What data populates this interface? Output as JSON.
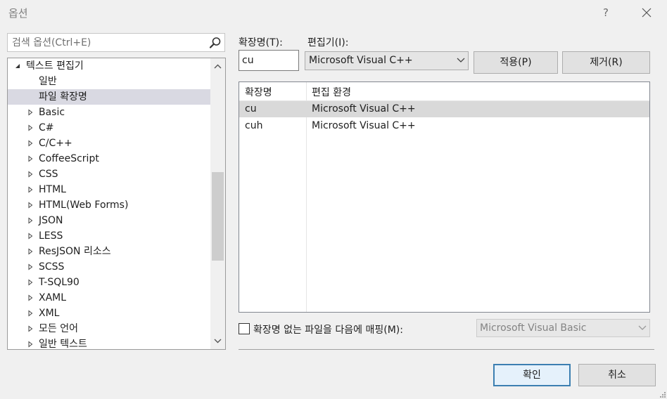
{
  "window": {
    "title": "옵션",
    "help": "?"
  },
  "search": {
    "placeholder": "검색 옵션(Ctrl+E)"
  },
  "tree": {
    "items": [
      {
        "label": "텍스트 편집기",
        "arrow": "expanded",
        "level": 0
      },
      {
        "label": "일반",
        "arrow": "none",
        "level": 1
      },
      {
        "label": "파일 확장명",
        "arrow": "none",
        "level": 1,
        "selected": true
      },
      {
        "label": "Basic",
        "arrow": "collapsed",
        "level": 1
      },
      {
        "label": "C#",
        "arrow": "collapsed",
        "level": 1
      },
      {
        "label": "C/C++",
        "arrow": "collapsed",
        "level": 1
      },
      {
        "label": "CoffeeScript",
        "arrow": "collapsed",
        "level": 1
      },
      {
        "label": "CSS",
        "arrow": "collapsed",
        "level": 1
      },
      {
        "label": "HTML",
        "arrow": "collapsed",
        "level": 1
      },
      {
        "label": "HTML(Web Forms)",
        "arrow": "collapsed",
        "level": 1
      },
      {
        "label": "JSON",
        "arrow": "collapsed",
        "level": 1
      },
      {
        "label": "LESS",
        "arrow": "collapsed",
        "level": 1
      },
      {
        "label": "ResJSON 리소스",
        "arrow": "collapsed",
        "level": 1
      },
      {
        "label": "SCSS",
        "arrow": "collapsed",
        "level": 1
      },
      {
        "label": "T-SQL90",
        "arrow": "collapsed",
        "level": 1
      },
      {
        "label": "XAML",
        "arrow": "collapsed",
        "level": 1
      },
      {
        "label": "XML",
        "arrow": "collapsed",
        "level": 1
      },
      {
        "label": "모든 언어",
        "arrow": "collapsed",
        "level": 1
      },
      {
        "label": "일반 텍스트",
        "arrow": "collapsed",
        "level": 1
      }
    ]
  },
  "extension": {
    "label": "확장명(T):",
    "value": "cu"
  },
  "editor": {
    "label": "편집기(I):",
    "selected": "Microsoft Visual C++"
  },
  "buttons": {
    "apply": "적용(P)",
    "remove": "제거(R)",
    "ok": "확인",
    "cancel": "취소"
  },
  "list": {
    "headers": [
      "확장명",
      "편집 환경"
    ],
    "rows": [
      {
        "ext": "cu",
        "editor": "Microsoft Visual C++",
        "selected": true
      },
      {
        "ext": "cuh",
        "editor": "Microsoft Visual C++",
        "selected": false
      }
    ]
  },
  "nomap": {
    "label": "확장명 없는 파일을 다음에 매핑(M):",
    "checked": false,
    "selected": "Microsoft Visual Basic"
  }
}
